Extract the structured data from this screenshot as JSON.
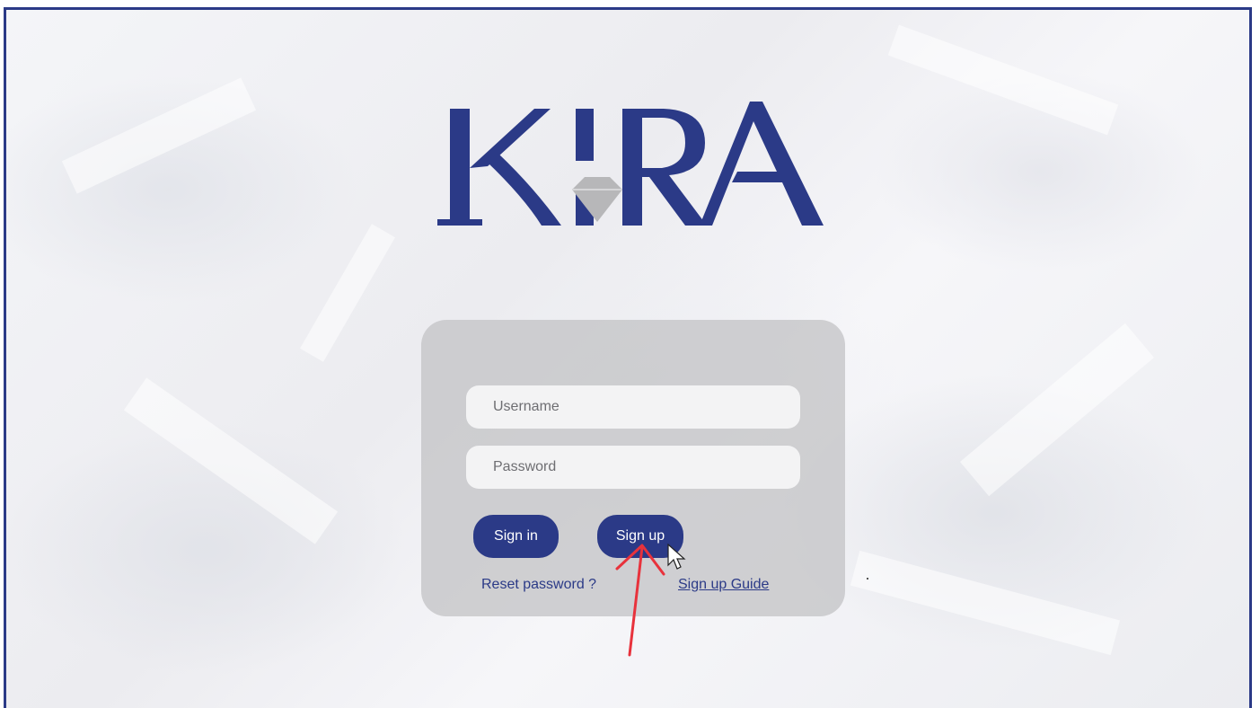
{
  "brand": {
    "name": "KIRA",
    "primary_color": "#2b3a87",
    "diamond_color": "#b7b7b9"
  },
  "login_form": {
    "username_placeholder": "Username",
    "password_placeholder": "Password",
    "sign_in_label": "Sign in",
    "sign_up_label": "Sign up",
    "reset_password_label": "Reset password ?",
    "sign_up_guide_label": "Sign up Guide"
  },
  "annotation": {
    "arrow_color": "#e8323c",
    "icon": "mouse-pointer-icon"
  }
}
